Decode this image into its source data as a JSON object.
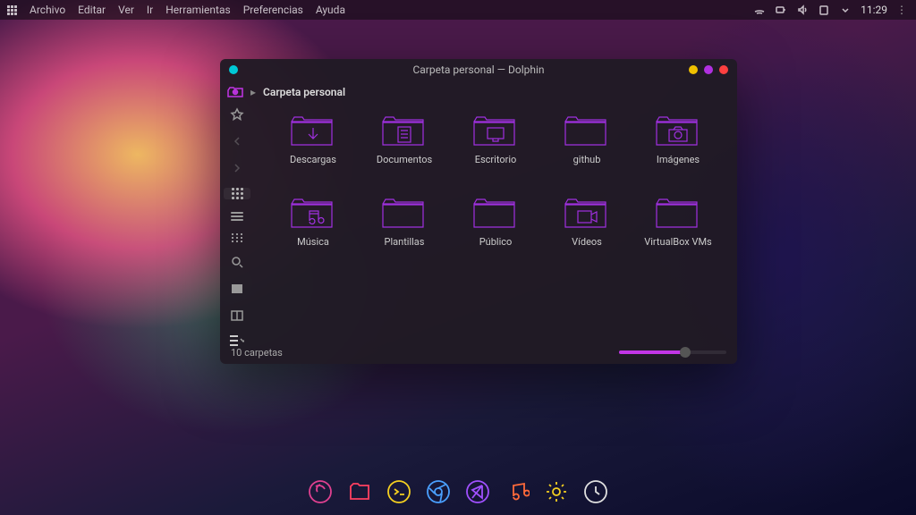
{
  "menubar": {
    "items": [
      "Archivo",
      "Editar",
      "Ver",
      "Ir",
      "Herramientas",
      "Preferencias",
      "Ayuda"
    ]
  },
  "tray": {
    "clock": "11:29"
  },
  "window": {
    "title": "Carpeta personal — Dolphin",
    "dot_colors": {
      "left": "#00c8d6",
      "min": "#f0c000",
      "max": "#b030e0",
      "close": "#ff4040"
    },
    "breadcrumb": {
      "root": "Carpeta personal"
    },
    "folders": [
      {
        "name": "Descargas",
        "icon": "download"
      },
      {
        "name": "Documentos",
        "icon": "document"
      },
      {
        "name": "Escritorio",
        "icon": "desktop"
      },
      {
        "name": "github",
        "icon": "folder"
      },
      {
        "name": "Imágenes",
        "icon": "camera"
      },
      {
        "name": "Música",
        "icon": "music"
      },
      {
        "name": "Plantillas",
        "icon": "folder"
      },
      {
        "name": "Público",
        "icon": "folder"
      },
      {
        "name": "Vídeos",
        "icon": "video"
      },
      {
        "name": "VirtualBox VMs",
        "icon": "folder"
      }
    ],
    "status": "10 carpetas"
  },
  "dock": {
    "items": [
      {
        "name": "firefox",
        "color": "#e04090"
      },
      {
        "name": "files",
        "color": "#ff4060"
      },
      {
        "name": "terminal",
        "color": "#f5d020"
      },
      {
        "name": "chrome",
        "color": "#4aa0ff"
      },
      {
        "name": "vscode",
        "color": "#a050ff"
      },
      {
        "name": "music",
        "color": "#ff6a3a"
      },
      {
        "name": "settings",
        "color": "#f5d020"
      },
      {
        "name": "clock",
        "color": "#e0e0e0"
      }
    ]
  }
}
